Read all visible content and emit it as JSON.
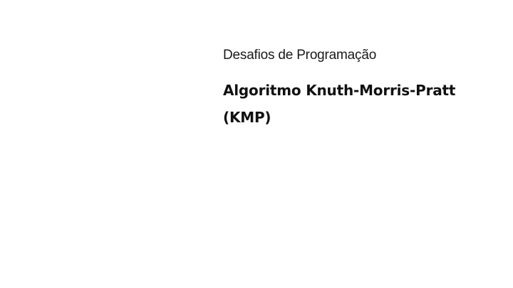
{
  "slide": {
    "subtitle": "Desafios de Programação",
    "title_line_1": "Algoritmo Knuth-Morris-Pratt",
    "title_line_2": "(KMP)"
  }
}
